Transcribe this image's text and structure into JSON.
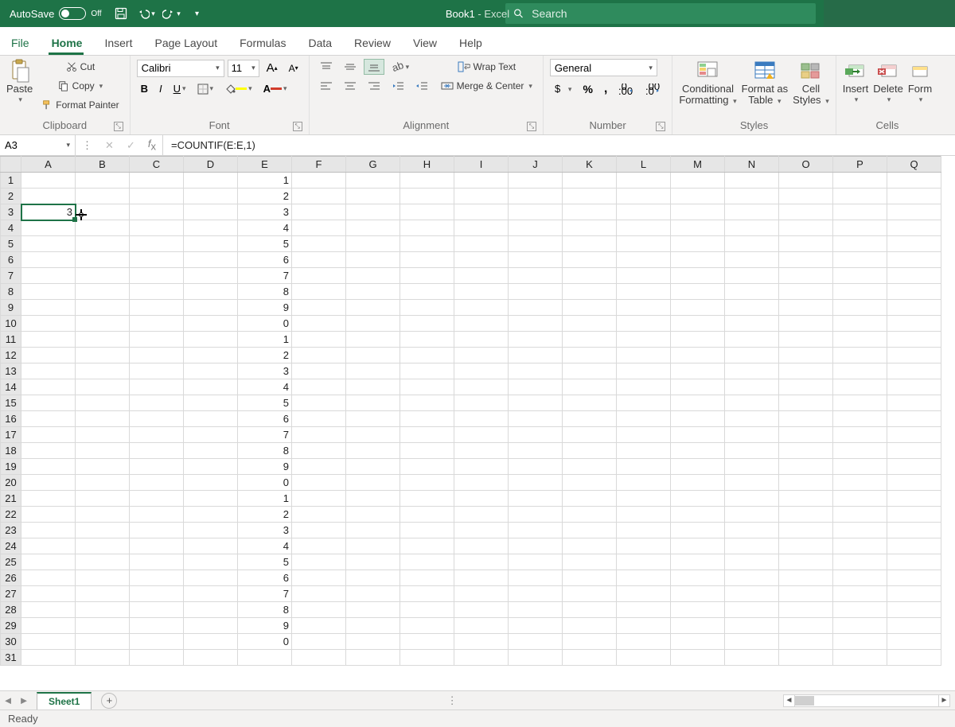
{
  "titlebar": {
    "autosave_label": "AutoSave",
    "autosave_state": "Off",
    "doc_name": "Book1",
    "app_suffix": "  -  Excel",
    "search_placeholder": "Search"
  },
  "tabs": [
    "File",
    "Home",
    "Insert",
    "Page Layout",
    "Formulas",
    "Data",
    "Review",
    "View",
    "Help"
  ],
  "active_tab": "Home",
  "ribbon": {
    "clipboard": {
      "label": "Clipboard",
      "paste": "Paste",
      "cut": "Cut",
      "copy": "Copy",
      "fmtpainter": "Format Painter"
    },
    "font": {
      "label": "Font",
      "name": "Calibri",
      "size": "11"
    },
    "alignment": {
      "label": "Alignment",
      "wrap": "Wrap Text",
      "merge": "Merge & Center"
    },
    "number": {
      "label": "Number",
      "format": "General"
    },
    "styles": {
      "label": "Styles",
      "cond": "Conditional",
      "cond2": "Formatting",
      "fat": "Format as",
      "fat2": "Table",
      "cell": "Cell",
      "cell2": "Styles"
    },
    "cells": {
      "label": "Cells",
      "insert": "Insert",
      "delete": "Delete",
      "format": "Form"
    }
  },
  "fbar": {
    "name": "A3",
    "formula": "=COUNTIF(E:E,1)"
  },
  "grid": {
    "columns": [
      "A",
      "B",
      "C",
      "D",
      "E",
      "F",
      "G",
      "H",
      "I",
      "J",
      "K",
      "L",
      "M",
      "N",
      "O",
      "P",
      "Q"
    ],
    "selected": {
      "ref": "A3",
      "value": "3",
      "row": 3,
      "col": "A"
    },
    "cells": {
      "A3": "3",
      "E1": "1",
      "E2": "2",
      "E3": "3",
      "E4": "4",
      "E5": "5",
      "E6": "6",
      "E7": "7",
      "E8": "8",
      "E9": "9",
      "E10": "0",
      "E11": "1",
      "E12": "2",
      "E13": "3",
      "E14": "4",
      "E15": "5",
      "E16": "6",
      "E17": "7",
      "E18": "8",
      "E19": "9",
      "E20": "0",
      "E21": "1",
      "E22": "2",
      "E23": "3",
      "E24": "4",
      "E25": "5",
      "E26": "6",
      "E27": "7",
      "E28": "8",
      "E29": "9",
      "E30": "0"
    },
    "rows": 31
  },
  "sheetbar": {
    "active": "Sheet1"
  },
  "statusbar": {
    "status": "Ready"
  }
}
